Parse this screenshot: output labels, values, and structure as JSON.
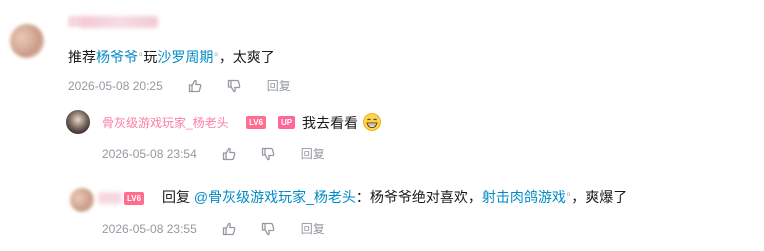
{
  "comment": {
    "text_prefix": "推荐",
    "link1": "杨爷爷",
    "link1_sup": "ᵒ",
    "text_mid": "玩",
    "link2": "沙罗周期",
    "link2_sup": "ᵒ",
    "text_suffix": "，太爽了",
    "timestamp": "2026-05-08 20:25",
    "reply_label": "回复"
  },
  "replies": [
    {
      "username": "骨灰级游戏玩家_杨老头",
      "level_badge": "LV6",
      "up_badge": "UP",
      "text": "我去看看",
      "emoji": "grinning-sweat-emoji",
      "timestamp": "2026-05-08 23:54",
      "reply_label": "回复"
    },
    {
      "level_badge": "LV6",
      "text_prefix": "回复 ",
      "mention": "@骨灰级游戏玩家_杨老头",
      "text_after_mention": "：杨爷爷绝对喜欢，",
      "link": "射击肉鸽游戏",
      "link_sup": "ᵒ",
      "text_suffix": "，爽爆了",
      "timestamp": "2026-05-08 23:55",
      "reply_label": "回复"
    }
  ],
  "icons": {
    "like": "thumbs-up-icon",
    "dislike": "thumbs-down-icon"
  },
  "colors": {
    "link": "#008ac5",
    "username": "#fb7299",
    "meta": "#9499a0"
  }
}
